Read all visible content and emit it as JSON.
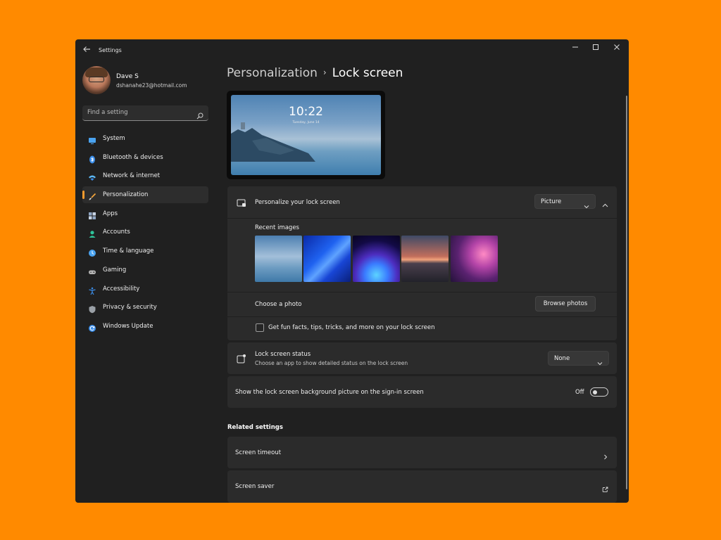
{
  "window": {
    "title": "Settings"
  },
  "profile": {
    "name": "Dave S",
    "email": "dshanahe23@hotmail.com"
  },
  "search": {
    "placeholder": "Find a setting"
  },
  "sidebar": {
    "items": [
      {
        "label": "System",
        "icon": "monitor-icon",
        "color": "#4AA3F0"
      },
      {
        "label": "Bluetooth & devices",
        "icon": "bluetooth-icon",
        "color": "#3B8EEA"
      },
      {
        "label": "Network & internet",
        "icon": "wifi-icon",
        "color": "#5DB8F5"
      },
      {
        "label": "Personalization",
        "icon": "brush-icon",
        "color": "#F2A33A",
        "active": true
      },
      {
        "label": "Apps",
        "icon": "apps-icon",
        "color": "#8FA6C4"
      },
      {
        "label": "Accounts",
        "icon": "person-icon",
        "color": "#2FC39A"
      },
      {
        "label": "Time & language",
        "icon": "globe-clock-icon",
        "color": "#4AA3F0"
      },
      {
        "label": "Gaming",
        "icon": "gamepad-icon",
        "color": "#B6B6B6"
      },
      {
        "label": "Accessibility",
        "icon": "accessibility-icon",
        "color": "#3B8EEA"
      },
      {
        "label": "Privacy & security",
        "icon": "shield-icon",
        "color": "#9AA0A6"
      },
      {
        "label": "Windows Update",
        "icon": "update-icon",
        "color": "#3B8EEA"
      }
    ]
  },
  "header": {
    "parent": "Personalization",
    "separator": "›",
    "current": "Lock screen"
  },
  "preview": {
    "time": "10:22",
    "date": "Tuesday, June 14"
  },
  "personalize": {
    "label": "Personalize your lock screen",
    "dropdown_value": "Picture",
    "recent_images_label": "Recent images",
    "choose_photo_label": "Choose a photo",
    "browse_button": "Browse photos",
    "fun_facts_label": "Get fun facts, tips, tricks, and more on your lock screen"
  },
  "status": {
    "label": "Lock screen status",
    "sublabel": "Choose an app to show detailed status on the lock screen",
    "dropdown_value": "None"
  },
  "signin": {
    "label": "Show the lock screen background picture on the sign-in screen",
    "toggle_state": "Off"
  },
  "related": {
    "title": "Related settings",
    "items": [
      {
        "label": "Screen timeout",
        "icon": "chevron-right-icon"
      },
      {
        "label": "Screen saver",
        "icon": "external-link-icon"
      }
    ]
  },
  "colors": {
    "background": "#FF8A00",
    "window": "#202020",
    "card": "#2B2B2B",
    "accent": "#F79B2E"
  }
}
